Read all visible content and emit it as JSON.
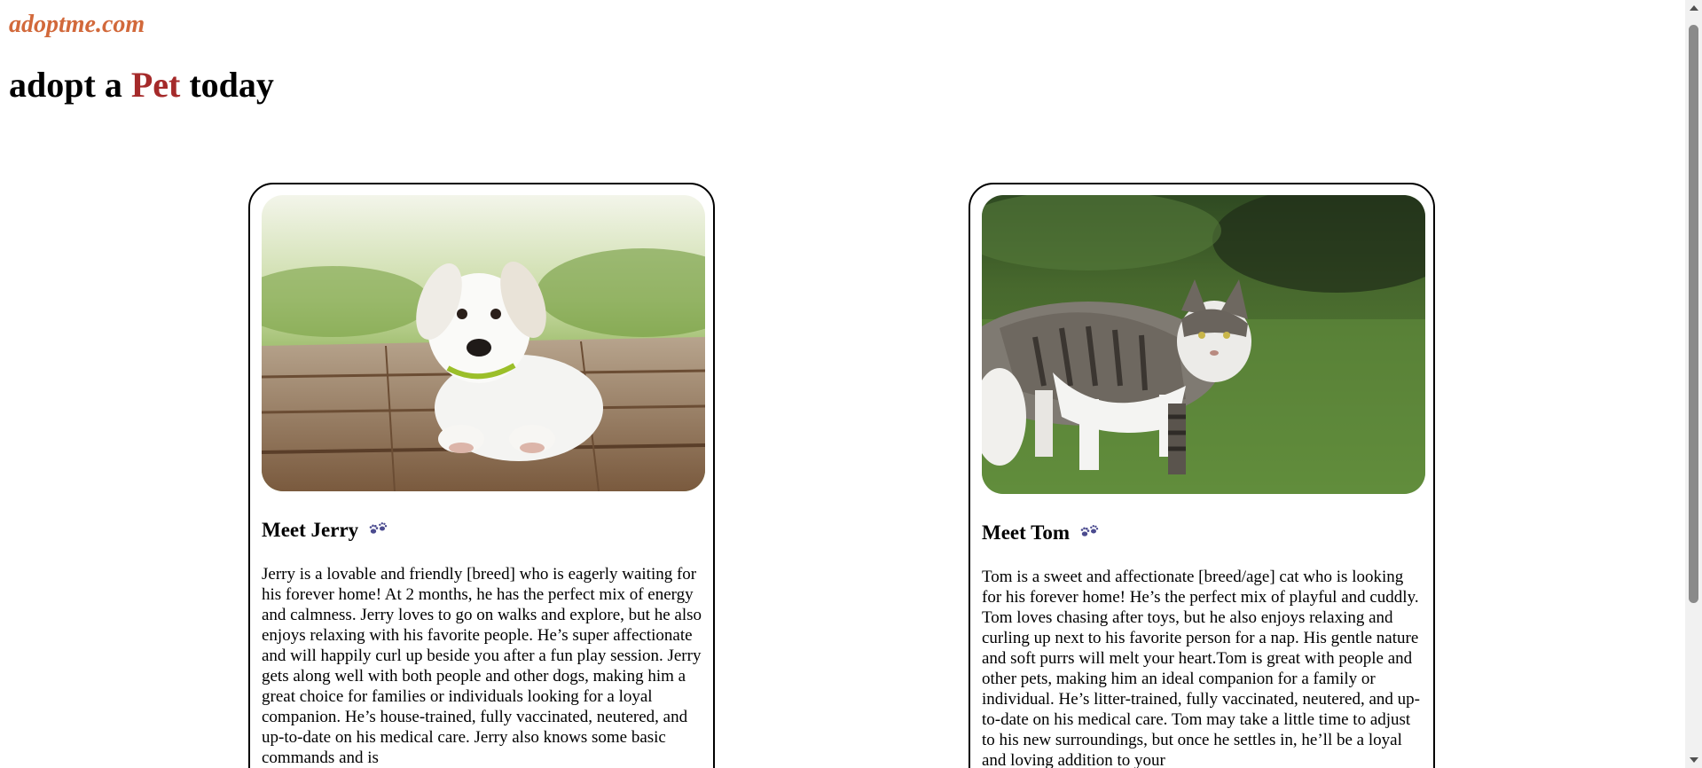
{
  "site": {
    "name": "adoptme.com"
  },
  "headline": {
    "before": "adopt a ",
    "accent": "Pet",
    "after": " today"
  },
  "colors": {
    "site_name": "#d2693b",
    "accent": "#a52a2a",
    "paw": "#4b4b8f"
  },
  "pets": [
    {
      "name": "Meet Jerry",
      "photo": "puppy-photo",
      "icon": "paw-prints-icon",
      "description": "Jerry is a lovable and friendly [breed] who is eagerly waiting for his forever home! At 2 months, he has the perfect mix of energy and calmness. Jerry loves to go on walks and explore, but he also enjoys relaxing with his favorite people. He’s super affectionate and will happily curl up beside you after a fun play session. Jerry gets along well with both people and other dogs, making him a great choice for families or individuals looking for a loyal companion. He’s house-trained, fully vaccinated, neutered, and up-to-date on his medical care. Jerry also knows some basic commands and is"
    },
    {
      "name": "Meet Tom",
      "photo": "cat-photo",
      "icon": "paw-prints-icon",
      "description": "Tom is a sweet and affectionate [breed/age] cat who is looking for his forever home! He’s the perfect mix of playful and cuddly. Tom loves chasing after toys, but he also enjoys relaxing and curling up next to his favorite person for a nap. His gentle nature and soft purrs will melt your heart.Tom is great with people and other pets, making him an ideal companion for a family or individual. He’s litter-trained, fully vaccinated, neutered, and up-to-date on his medical care. Tom may take a little time to adjust to his new surroundings, but once he settles in, he’ll be a loyal and loving addition to your"
    }
  ]
}
